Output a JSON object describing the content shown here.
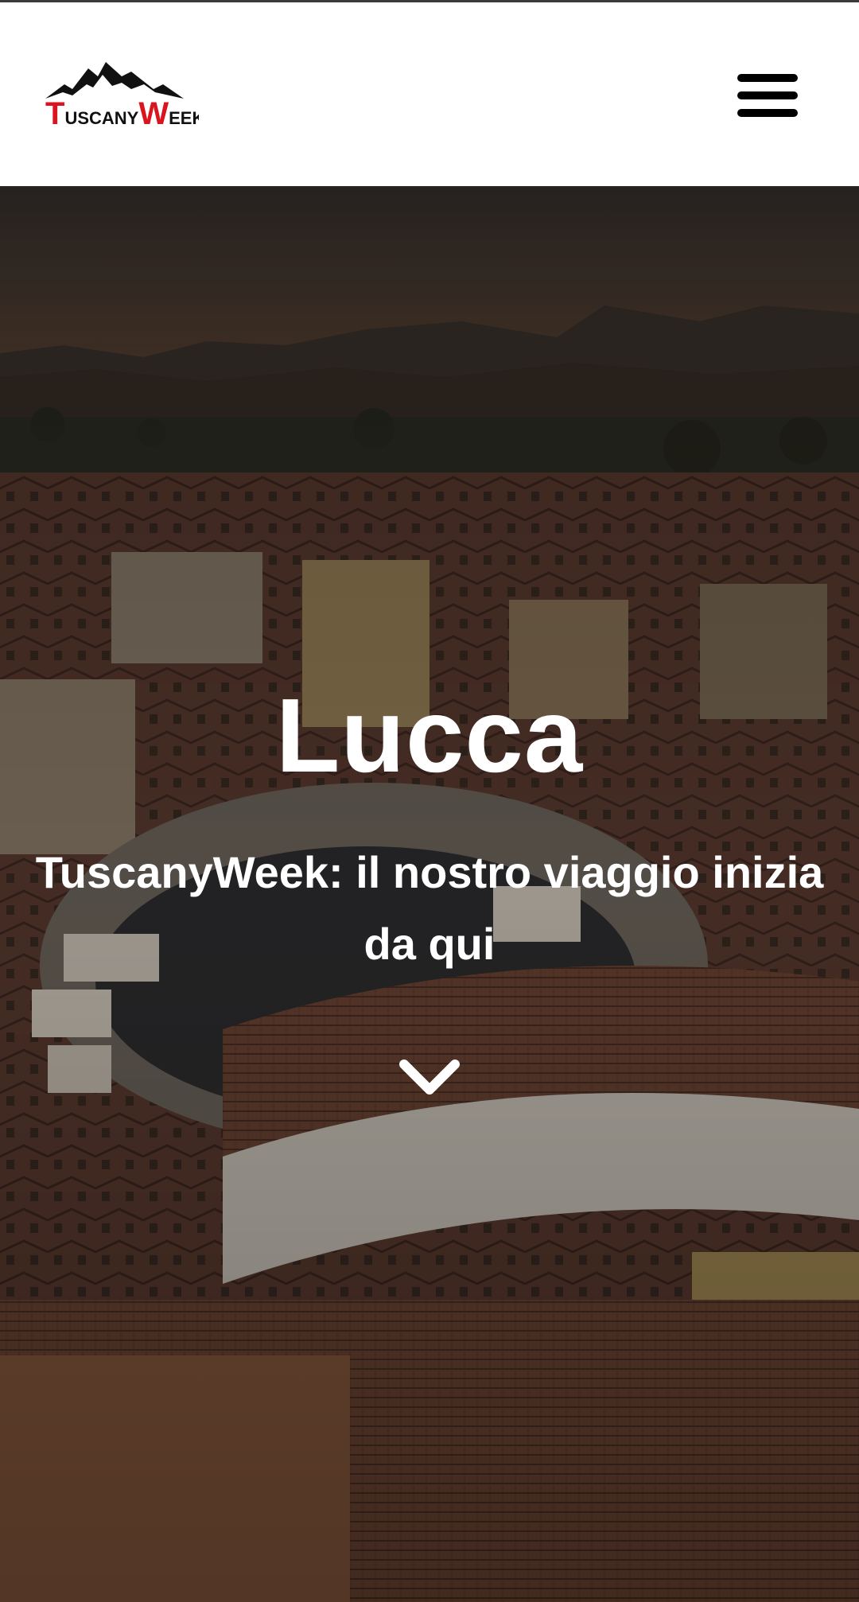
{
  "header": {
    "logo": {
      "text_first_big": "T",
      "text_first_rest": "USCANY",
      "text_second_big": "W",
      "text_second_rest": "EEK",
      "accent_color": "#d9161f",
      "text_color": "#111111"
    },
    "menu_icon": "hamburger-menu-icon"
  },
  "hero": {
    "title": "Lucca",
    "subtitle": "TuscanyWeek: il nostro viaggio inizia da qui",
    "scroll_icon": "chevron-down-icon",
    "overlay_color": "#000000"
  },
  "colors": {
    "header_bg": "#ffffff",
    "hero_text": "#ffffff"
  }
}
